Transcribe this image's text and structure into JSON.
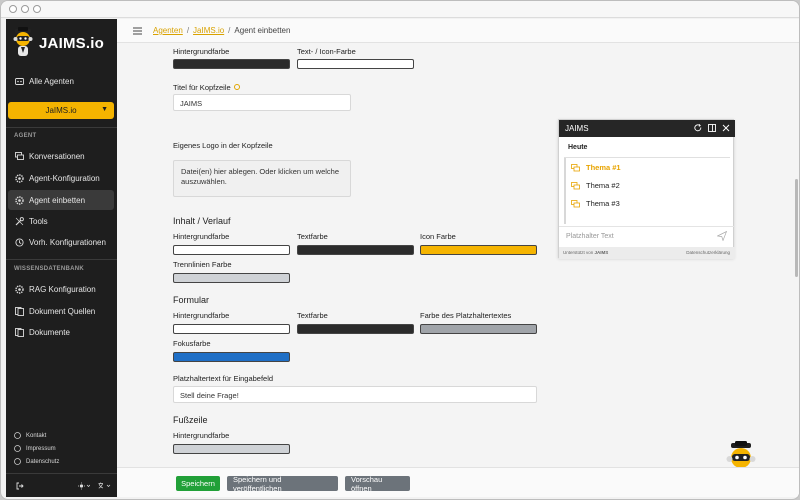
{
  "colors": {
    "accent": "#f5b400",
    "sidebar_bg": "#1e1e1e",
    "primary_button": "#21a038",
    "secondary_button": "#6c737a"
  },
  "sidebar": {
    "brand": "JAIMS.io",
    "all_agents": "Alle Agenten",
    "agent_select": "JaIMS.io",
    "section_agent": "AGENT",
    "agent_items": [
      {
        "label": "Konversationen",
        "icon": "chat-icon"
      },
      {
        "label": "Agent-Konfiguration",
        "icon": "gear-icon"
      },
      {
        "label": "Agent einbetten",
        "icon": "embed-icon"
      },
      {
        "label": "Tools",
        "icon": "tools-icon"
      },
      {
        "label": "Vorh. Konfigurationen",
        "icon": "history-icon"
      }
    ],
    "section_knowledge": "WISSENSDATENBANK",
    "knowledge_items": [
      {
        "label": "RAG Konfiguration",
        "icon": "gear-icon"
      },
      {
        "label": "Dokument Quellen",
        "icon": "sources-icon"
      },
      {
        "label": "Dokumente",
        "icon": "documents-icon"
      }
    ],
    "footer_links": [
      {
        "label": "Kontakt",
        "icon": "contact-icon"
      },
      {
        "label": "Impressum",
        "icon": "info-icon"
      },
      {
        "label": "Datenschutz",
        "icon": "privacy-icon"
      }
    ]
  },
  "breadcrumb": {
    "link1": "Agenten",
    "link2": "JaIMS.io",
    "current": "Agent einbetten"
  },
  "form": {
    "header_bg_label": "Hintergrundfarbe",
    "header_text_label": "Text- / Icon-Farbe",
    "header_bg_color": "#2b2b2b",
    "header_text_color": "#ffffff",
    "title_label": "Titel für Kopfzeile",
    "title_value": "JAIMS",
    "logo_label": "Eigenes Logo in der Kopfzeile",
    "logo_drop_text": "Datei(en) hier ablegen. Oder klicken um welche auszuwählen.",
    "content_heading": "Inhalt / Verlauf",
    "content_bg_label": "Hintergrundfarbe",
    "content_text_label": "Textfarbe",
    "content_icon_label": "Icon Farbe",
    "content_divider_label": "Trennlinien Farbe",
    "content_bg_color": "#ffffff",
    "content_text_color": "#2b2b2b",
    "content_icon_color": "#f5b400",
    "content_divider_color": "#cfd2d6",
    "form_heading": "Formular",
    "form_bg_label": "Hintergrundfarbe",
    "form_text_label": "Textfarbe",
    "form_placeholder_label": "Farbe des Platzhaltertextes",
    "form_focus_label": "Fokusfarbe",
    "form_bg_color": "#ffffff",
    "form_text_color": "#2b2b2b",
    "form_placeholder_color": "#a0a4a9",
    "form_focus_color": "#1f6fc6",
    "placeholder_label": "Platzhaltertext für Eingabefeld",
    "placeholder_value": "Stell deine Frage!",
    "footer_heading": "Fußzeile",
    "footer_bg_label": "Hintergrundfarbe",
    "footer_bg_color": "#cfd2d6"
  },
  "preview": {
    "title": "JAIMS",
    "today": "Heute",
    "topics": [
      "Thema #1",
      "Thema #2",
      "Thema #3"
    ],
    "placeholder": "Platzhalter Text",
    "powered_by_prefix": "Unterstützt von",
    "powered_by_brand": "JAIMS",
    "privacy": "Datenschutzerklärung"
  },
  "buttons": {
    "save": "Speichern",
    "save_publish": "Speichern und veröffentlichen",
    "preview": "Vorschau öffnen"
  }
}
